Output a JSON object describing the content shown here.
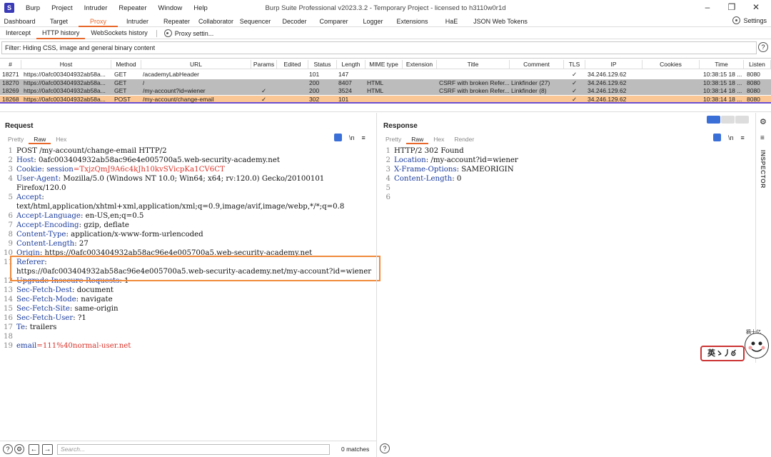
{
  "app": {
    "logo": "S",
    "title": "Burp Suite Professional v2023.3.2 - Temporary Project - licensed to h3110w0r1d",
    "menu": [
      "Burp",
      "Project",
      "Intruder",
      "Repeater",
      "Window",
      "Help"
    ]
  },
  "main_tabs": [
    "Dashboard",
    "Target",
    "Proxy",
    "Intruder",
    "Repeater",
    "Collaborator",
    "Sequencer",
    "Decoder",
    "Comparer",
    "Logger",
    "Extensions",
    "HaE",
    "JSON Web Tokens"
  ],
  "active_main_tab": "Proxy",
  "settings_label": "Settings",
  "sub_tabs": [
    "Intercept",
    "HTTP history",
    "WebSockets history"
  ],
  "proxy_settings_label": "Proxy settin...",
  "filter_text": "Filter: Hiding CSS, image and general binary content",
  "history": {
    "columns": [
      "#",
      "Host",
      "Method",
      "URL",
      "Params",
      "Edited",
      "Status",
      "Length",
      "MIME type",
      "Extension",
      "Title",
      "Comment",
      "TLS",
      "IP",
      "Cookies",
      "Time",
      "Listen"
    ],
    "rows": [
      {
        "num": "18271",
        "host": "https://0afc003404932ab58a...",
        "method": "GET",
        "url": "/academyLabHeader",
        "params": "",
        "status": "101",
        "length": "147",
        "mime": "",
        "title": "",
        "comment": "",
        "tls": "✓",
        "ip": "34.246.129.62",
        "time": "10:38:15 18 ...",
        "listen": "8080",
        "style": "white"
      },
      {
        "num": "18270",
        "host": "https://0afc003404932ab58a...",
        "method": "GET",
        "url": "/",
        "params": "",
        "status": "200",
        "length": "8407",
        "mime": "HTML",
        "title": "CSRF with broken Refer...",
        "comment": "Linkfinder (27)",
        "tls": "✓",
        "ip": "34.246.129.62",
        "time": "10:38:15 18 ...",
        "listen": "8080",
        "style": "gray"
      },
      {
        "num": "18269",
        "host": "https://0afc003404932ab58a...",
        "method": "GET",
        "url": "/my-account?id=wiener",
        "params": "✓",
        "status": "200",
        "length": "3524",
        "mime": "HTML",
        "title": "CSRF with broken Refer...",
        "comment": "Linkfinder (8)",
        "tls": "✓",
        "ip": "34.246.129.62",
        "time": "10:38:14 18 ...",
        "listen": "8080",
        "style": "gray"
      },
      {
        "num": "18268",
        "host": "https://0afc003404932ab58a...",
        "method": "POST",
        "url": "/my-account/change-email",
        "params": "✓",
        "status": "302",
        "length": "101",
        "mime": "",
        "title": "",
        "comment": "",
        "tls": "✓",
        "ip": "34.246.129.62",
        "time": "10:38:14 18 ...",
        "listen": "8080",
        "style": "orange"
      }
    ]
  },
  "request": {
    "title": "Request",
    "tabs": [
      "Pretty",
      "Raw",
      "Hex"
    ],
    "newline_toggle": "\\n",
    "lines": [
      {
        "n": "1",
        "parts": [
          {
            "t": "POST /my-account/change-email HTTP/2",
            "c": "val"
          }
        ]
      },
      {
        "n": "2",
        "parts": [
          {
            "t": "Host",
            "c": "hdr"
          },
          {
            "t": ": 0afc003404932ab58ac96e4e005700a5.web-security-academy.net",
            "c": "val"
          }
        ]
      },
      {
        "n": "3",
        "parts": [
          {
            "t": "Cookie",
            "c": "hdr"
          },
          {
            "t": ": ",
            "c": "val"
          },
          {
            "t": "session",
            "c": "hdr"
          },
          {
            "t": "=TxjzQmJ9A6c4kJh10kvSVicpKa1CV6CT",
            "c": "cookie"
          }
        ]
      },
      {
        "n": "4",
        "parts": [
          {
            "t": "User-Agent",
            "c": "hdr"
          },
          {
            "t": ": Mozilla/5.0 (Windows NT 10.0; Win64; x64; rv:120.0) Gecko/20100101",
            "c": "val"
          }
        ]
      },
      {
        "n": "",
        "parts": [
          {
            "t": "Firefox/120.0",
            "c": "val"
          }
        ]
      },
      {
        "n": "5",
        "parts": [
          {
            "t": "Accept",
            "c": "hdr"
          },
          {
            "t": ":",
            "c": "val"
          }
        ]
      },
      {
        "n": "",
        "parts": [
          {
            "t": "text/html,application/xhtml+xml,application/xml;q=0.9,image/avif,image/webp,*/*;q=0.8",
            "c": "val"
          }
        ]
      },
      {
        "n": "6",
        "parts": [
          {
            "t": "Accept-Language",
            "c": "hdr"
          },
          {
            "t": ": en-US,en;q=0.5",
            "c": "val"
          }
        ]
      },
      {
        "n": "7",
        "parts": [
          {
            "t": "Accept-Encoding",
            "c": "hdr"
          },
          {
            "t": ": gzip, deflate",
            "c": "val"
          }
        ]
      },
      {
        "n": "8",
        "parts": [
          {
            "t": "Content-Type",
            "c": "hdr"
          },
          {
            "t": ": application/x-www-form-urlencoded",
            "c": "val"
          }
        ]
      },
      {
        "n": "9",
        "parts": [
          {
            "t": "Content-Length",
            "c": "hdr"
          },
          {
            "t": ": 27",
            "c": "val"
          }
        ]
      },
      {
        "n": "10",
        "parts": [
          {
            "t": "Origin",
            "c": "hdr"
          },
          {
            "t": ": https://0afc003404932ab58ac96e4e005700a5.web-security-academy.net",
            "c": "val"
          }
        ]
      },
      {
        "n": "11",
        "parts": [
          {
            "t": "Referer",
            "c": "hdr"
          },
          {
            "t": ":",
            "c": "val"
          }
        ]
      },
      {
        "n": "",
        "parts": [
          {
            "t": "https://0afc003404932ab58ac96e4e005700a5.web-security-academy.net/my-account?id=wiener",
            "c": "val"
          }
        ]
      },
      {
        "n": "12",
        "parts": [
          {
            "t": "Upgrade-Insecure-Requests",
            "c": "hdr"
          },
          {
            "t": ": 1",
            "c": "val"
          }
        ]
      },
      {
        "n": "13",
        "parts": [
          {
            "t": "Sec-Fetch-Dest",
            "c": "hdr"
          },
          {
            "t": ": document",
            "c": "val"
          }
        ]
      },
      {
        "n": "14",
        "parts": [
          {
            "t": "Sec-Fetch-Mode",
            "c": "hdr"
          },
          {
            "t": ": navigate",
            "c": "val"
          }
        ]
      },
      {
        "n": "15",
        "parts": [
          {
            "t": "Sec-Fetch-Site",
            "c": "hdr"
          },
          {
            "t": ": same-origin",
            "c": "val"
          }
        ]
      },
      {
        "n": "16",
        "parts": [
          {
            "t": "Sec-Fetch-User",
            "c": "hdr"
          },
          {
            "t": ": ?1",
            "c": "val"
          }
        ]
      },
      {
        "n": "17",
        "parts": [
          {
            "t": "Te",
            "c": "hdr"
          },
          {
            "t": ": trailers",
            "c": "val"
          }
        ]
      },
      {
        "n": "18",
        "parts": []
      },
      {
        "n": "19",
        "parts": [
          {
            "t": "email",
            "c": "param"
          },
          {
            "t": "=111%40normal-user.net",
            "c": "paramval"
          }
        ]
      }
    ]
  },
  "response": {
    "title": "Response",
    "tabs": [
      "Pretty",
      "Raw",
      "Hex",
      "Render"
    ],
    "newline_toggle": "\\n",
    "lines": [
      {
        "n": "1",
        "parts": [
          {
            "t": "HTTP/2 302 Found",
            "c": "val"
          }
        ]
      },
      {
        "n": "2",
        "parts": [
          {
            "t": "Location",
            "c": "hdr"
          },
          {
            "t": ": /my-account?id=wiener",
            "c": "val"
          }
        ]
      },
      {
        "n": "3",
        "parts": [
          {
            "t": "X-Frame-Options",
            "c": "hdr"
          },
          {
            "t": ": SAMEORIGIN",
            "c": "val"
          }
        ]
      },
      {
        "n": "4",
        "parts": [
          {
            "t": "Content-Length",
            "c": "hdr"
          },
          {
            "t": ": 0",
            "c": "val"
          }
        ]
      },
      {
        "n": "5",
        "parts": []
      },
      {
        "n": "6",
        "parts": []
      }
    ]
  },
  "inspector_label": "INSPECTOR",
  "search": {
    "placeholder": "Search...",
    "matches": "0 matches"
  },
  "sticker": {
    "caption": "摘十亿",
    "text": "英ゝ丿ఠ"
  },
  "colors": {
    "accent": "#e8672a",
    "selected_row": "#fbc795",
    "highlight": "#f08a3b",
    "header_name": "#1a3c9e",
    "cookie_value": "#d9342b"
  }
}
